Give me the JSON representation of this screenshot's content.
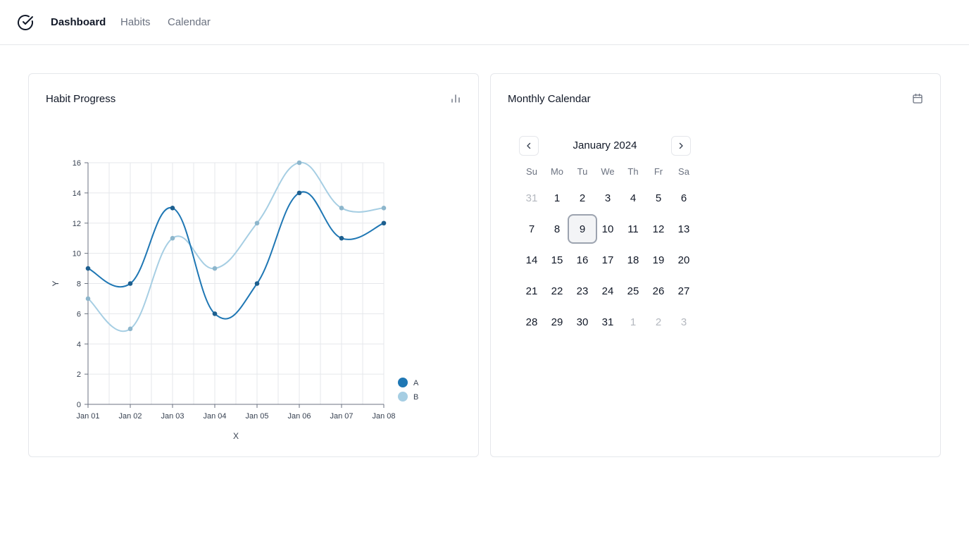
{
  "nav": {
    "logo_icon": "check-circle-icon",
    "links": [
      {
        "label": "Dashboard",
        "active": true
      },
      {
        "label": "Habits",
        "active": false
      },
      {
        "label": "Calendar",
        "active": false
      }
    ]
  },
  "progress_card": {
    "title": "Habit Progress",
    "icon": "bar-chart-icon"
  },
  "calendar_card": {
    "title": "Monthly Calendar",
    "icon": "calendar-icon",
    "month_label": "January 2024",
    "prev_icon": "chevron-left-icon",
    "next_icon": "chevron-right-icon",
    "weekdays": [
      "Su",
      "Mo",
      "Tu",
      "We",
      "Th",
      "Fr",
      "Sa"
    ],
    "weeks": [
      [
        {
          "d": "31",
          "o": true
        },
        {
          "d": "1"
        },
        {
          "d": "2"
        },
        {
          "d": "3"
        },
        {
          "d": "4"
        },
        {
          "d": "5"
        },
        {
          "d": "6"
        }
      ],
      [
        {
          "d": "7"
        },
        {
          "d": "8"
        },
        {
          "d": "9",
          "s": true
        },
        {
          "d": "10"
        },
        {
          "d": "11"
        },
        {
          "d": "12"
        },
        {
          "d": "13"
        }
      ],
      [
        {
          "d": "14"
        },
        {
          "d": "15"
        },
        {
          "d": "16"
        },
        {
          "d": "17"
        },
        {
          "d": "18"
        },
        {
          "d": "19"
        },
        {
          "d": "20"
        }
      ],
      [
        {
          "d": "21"
        },
        {
          "d": "22"
        },
        {
          "d": "23"
        },
        {
          "d": "24"
        },
        {
          "d": "25"
        },
        {
          "d": "26"
        },
        {
          "d": "27"
        }
      ],
      [
        {
          "d": "28"
        },
        {
          "d": "29"
        },
        {
          "d": "30"
        },
        {
          "d": "31"
        },
        {
          "d": "1",
          "o": true
        },
        {
          "d": "2",
          "o": true
        },
        {
          "d": "3",
          "o": true
        }
      ]
    ]
  },
  "chart_data": {
    "type": "line",
    "xlabel": "X",
    "ylabel": "Y",
    "categories": [
      "Jan 01",
      "Jan 02",
      "Jan 03",
      "Jan 04",
      "Jan 05",
      "Jan 06",
      "Jan 07",
      "Jan 08"
    ],
    "ylim": [
      0,
      16
    ],
    "yticks": [
      0,
      2,
      4,
      6,
      8,
      10,
      12,
      14,
      16
    ],
    "grid": true,
    "legend": "bottom-right",
    "series": [
      {
        "name": "A",
        "color": "#1f77b4",
        "values": [
          9,
          8,
          13,
          6,
          8,
          14,
          11,
          12
        ]
      },
      {
        "name": "B",
        "color": "#a6cee3",
        "values": [
          7,
          5,
          11,
          9,
          12,
          16,
          13,
          13
        ]
      }
    ]
  }
}
